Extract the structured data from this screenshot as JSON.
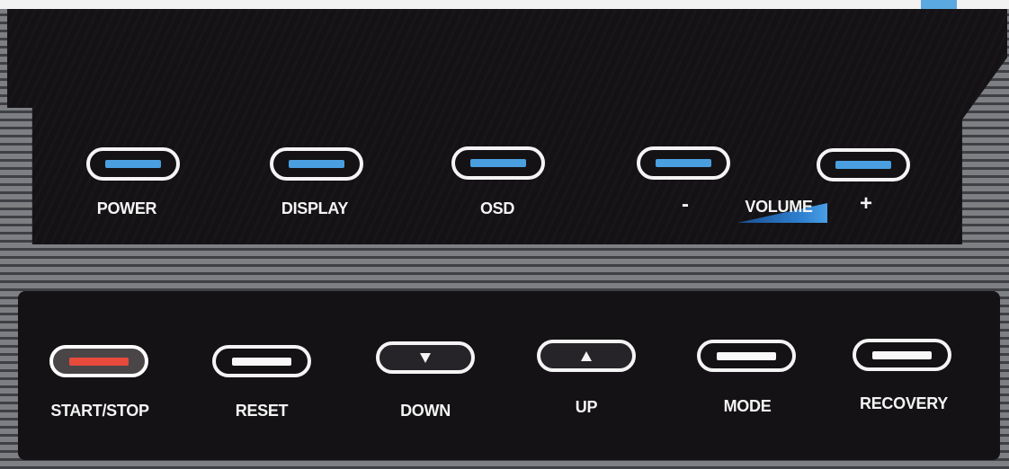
{
  "upper_buttons": [
    {
      "label": "POWER",
      "indicator": "blue"
    },
    {
      "label": "DISPLAY",
      "indicator": "blue"
    },
    {
      "label": "OSD",
      "indicator": "blue"
    },
    {
      "label": "-",
      "indicator": "blue"
    },
    {
      "label": "+",
      "indicator": "blue"
    }
  ],
  "volume_label": "VOLUME",
  "lower_buttons": [
    {
      "label": "START/STOP",
      "indicator": "red"
    },
    {
      "label": "RESET",
      "indicator": "white"
    },
    {
      "label": "DOWN",
      "icon": "down-triangle-icon"
    },
    {
      "label": "UP",
      "icon": "up-triangle-icon"
    },
    {
      "label": "MODE",
      "indicator": "white"
    },
    {
      "label": "RECOVERY",
      "indicator": "white"
    }
  ],
  "colors": {
    "panel": "#141214",
    "indicator_blue": "#4a9fe0",
    "indicator_red": "#e84a3c",
    "indicator_white": "#f8f8f8",
    "button_outline": "#f4f4f4",
    "volume_accent": "#2e7fcf"
  }
}
